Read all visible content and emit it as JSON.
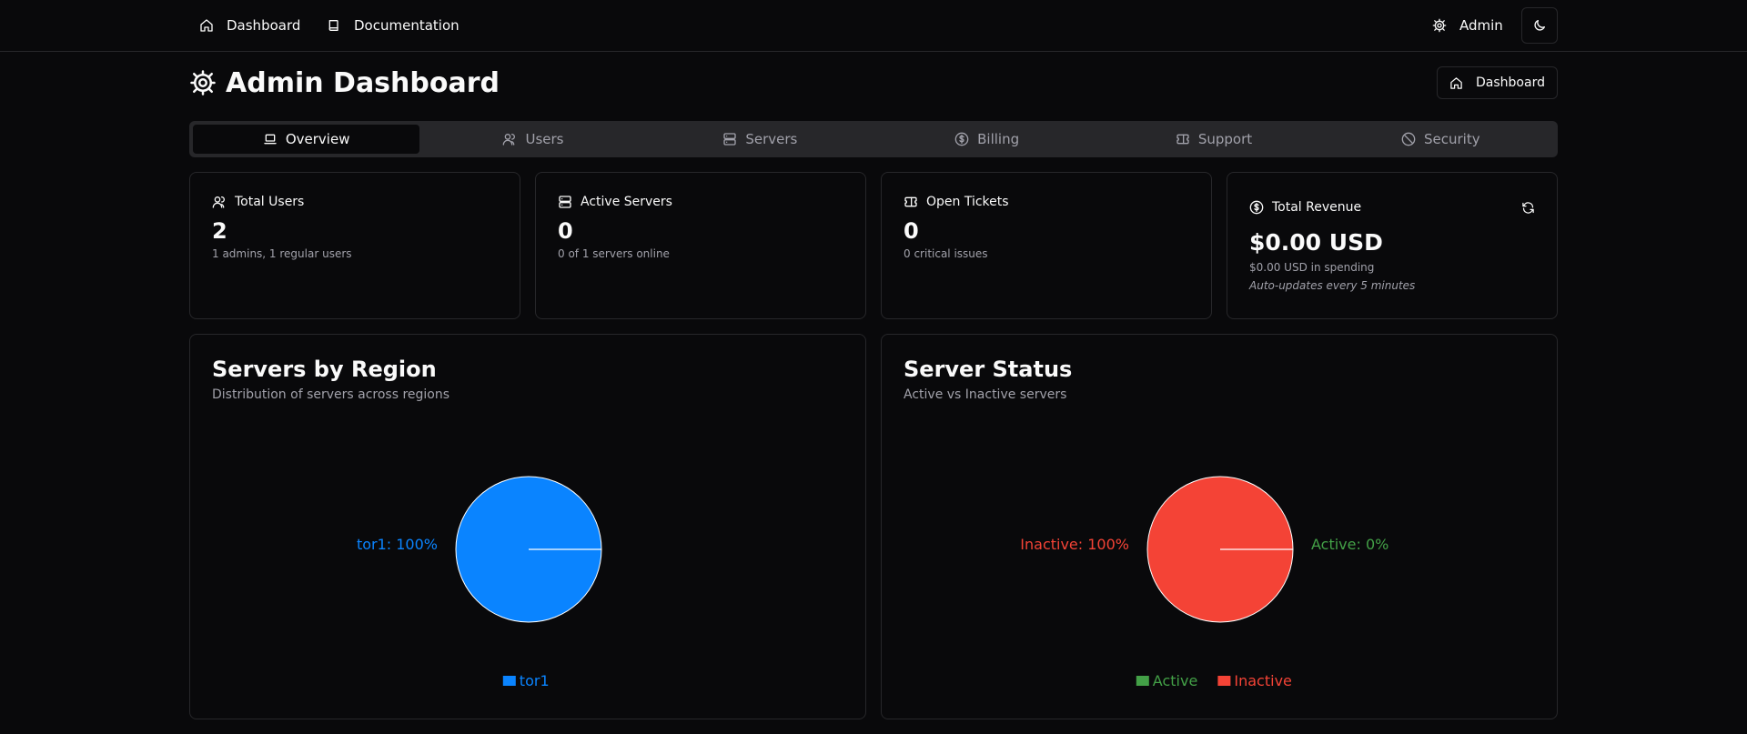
{
  "nav": {
    "dashboard_label": "Dashboard",
    "documentation_label": "Documentation",
    "admin_label": "Admin",
    "dashboard_icon": "home-icon",
    "documentation_icon": "book-icon",
    "admin_icon": "gear-icon",
    "theme_icon": "moon-icon"
  },
  "header": {
    "title": "Admin Dashboard",
    "title_icon": "gear-icon",
    "button_label": "Dashboard",
    "button_icon": "home-icon"
  },
  "tabs": [
    {
      "label": "Overview",
      "icon": "laptop-icon",
      "active": true
    },
    {
      "label": "Users",
      "icon": "users-icon",
      "active": false
    },
    {
      "label": "Servers",
      "icon": "server-icon",
      "active": false
    },
    {
      "label": "Billing",
      "icon": "dollar-circle-icon",
      "active": false
    },
    {
      "label": "Support",
      "icon": "ticket-icon",
      "active": false
    },
    {
      "label": "Security",
      "icon": "ban-icon",
      "active": false
    }
  ],
  "stats": {
    "users": {
      "title": "Total Users",
      "value": "2",
      "sub": "1 admins, 1 regular users",
      "icon": "users-icon"
    },
    "servers": {
      "title": "Active Servers",
      "value": "0",
      "sub": "0 of 1 servers online",
      "icon": "server-icon"
    },
    "tickets": {
      "title": "Open Tickets",
      "value": "0",
      "sub": "0 critical issues",
      "icon": "ticket-icon"
    },
    "revenue": {
      "title": "Total Revenue",
      "value": "$0.00 USD",
      "sub": "$0.00 USD in spending",
      "note": "Auto-updates every 5 minutes",
      "icon": "dollar-circle-icon",
      "refresh_icon": "refresh-icon"
    }
  },
  "colors": {
    "background": "#09090b",
    "border": "#27272a",
    "muted_text": "#a1a1aa",
    "region_tor1": "#0a84ff",
    "active": "#43a047",
    "inactive": "#f44336"
  },
  "chart_data": [
    {
      "type": "pie",
      "title": "Servers by Region",
      "subtitle": "Distribution of servers across regions",
      "slices": [
        {
          "name": "tor1",
          "value": 100,
          "label": "tor1: 100%",
          "color": "#0a84ff"
        }
      ],
      "legend": [
        "tor1"
      ],
      "legend_placement": "bottom"
    },
    {
      "type": "pie",
      "title": "Server Status",
      "subtitle": "Active vs Inactive servers",
      "slices": [
        {
          "name": "Active",
          "value": 0,
          "label": "Active: 0%",
          "color": "#43a047"
        },
        {
          "name": "Inactive",
          "value": 100,
          "label": "Inactive: 100%",
          "color": "#f44336"
        }
      ],
      "legend": [
        "Active",
        "Inactive"
      ],
      "legend_placement": "bottom"
    }
  ]
}
